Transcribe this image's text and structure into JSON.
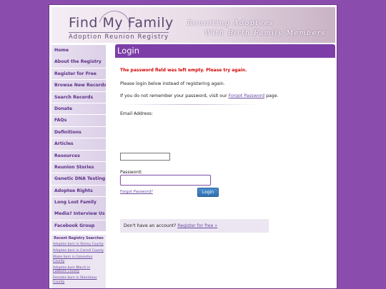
{
  "banner": {
    "logo_main": "Find My Family",
    "logo_sub": "Adoption Reunion Registry",
    "tagline_1": "Reuniting Adoptees",
    "tagline_2": "With Birth Family Members"
  },
  "nav": {
    "items": [
      "Home",
      "About the Registry",
      "Register for Free",
      "Browse New Records",
      "Search Records",
      "Donate",
      "FAQs",
      "Definitions",
      "Articles",
      "Resources",
      "Reunion Stories",
      "Genetic DNA Testing",
      "Adoptee Rights",
      "Long Lost Family",
      "Media? Interview Us",
      "Facebook Group"
    ]
  },
  "recent": {
    "title": "Recent Registry Searches",
    "links": [
      "Adoptee born in Storey County",
      "Adoptee born in Carroll County",
      "Males born in Galveston County",
      "Adoptee born March in Lubbock County",
      "Females born in Stanislaus County"
    ]
  },
  "login": {
    "title": "Login",
    "error": "The password field was left empty. Please try again.",
    "msg1": "Please login below instead of registering again.",
    "msg2_prefix": "If you do not remember your password, visit our ",
    "msg2_link": "Forgot Password",
    "msg2_suffix": " page.",
    "email_label": "Email Address:",
    "email_value": "",
    "password_label": "Password:",
    "password_value": "",
    "forgot_link": "Forgot Password?",
    "login_button": "Login",
    "signup_prefix": "Don't have an account? ",
    "signup_link": "Register for free »"
  }
}
